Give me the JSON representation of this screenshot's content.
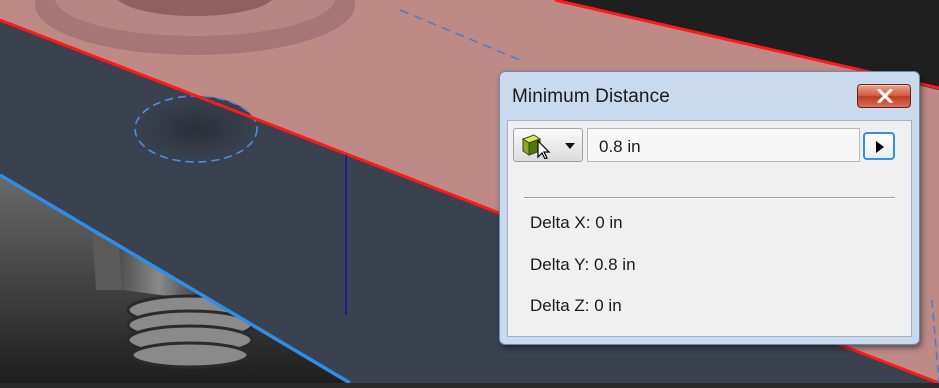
{
  "dialog": {
    "title": "Minimum Distance",
    "distance_value": "0.8 in",
    "selector_icon": "select-component-icon",
    "close_icon": "close-icon",
    "play_icon": "play-arrow-icon",
    "deltas": {
      "x": "Delta X: 0 in",
      "y": "Delta Y: 0.8 in",
      "z": "Delta Z: 0 in"
    }
  },
  "colors": {
    "titlebar": "#c9daec",
    "close_button": "#d65a40",
    "part_face_pink": "#bd8a86",
    "plate_dark": "#3a4250",
    "edge_highlight_red": "#ff1a1a",
    "edge_highlight_blue": "#2e8ee6",
    "measure_line": "#1a1aa0"
  }
}
